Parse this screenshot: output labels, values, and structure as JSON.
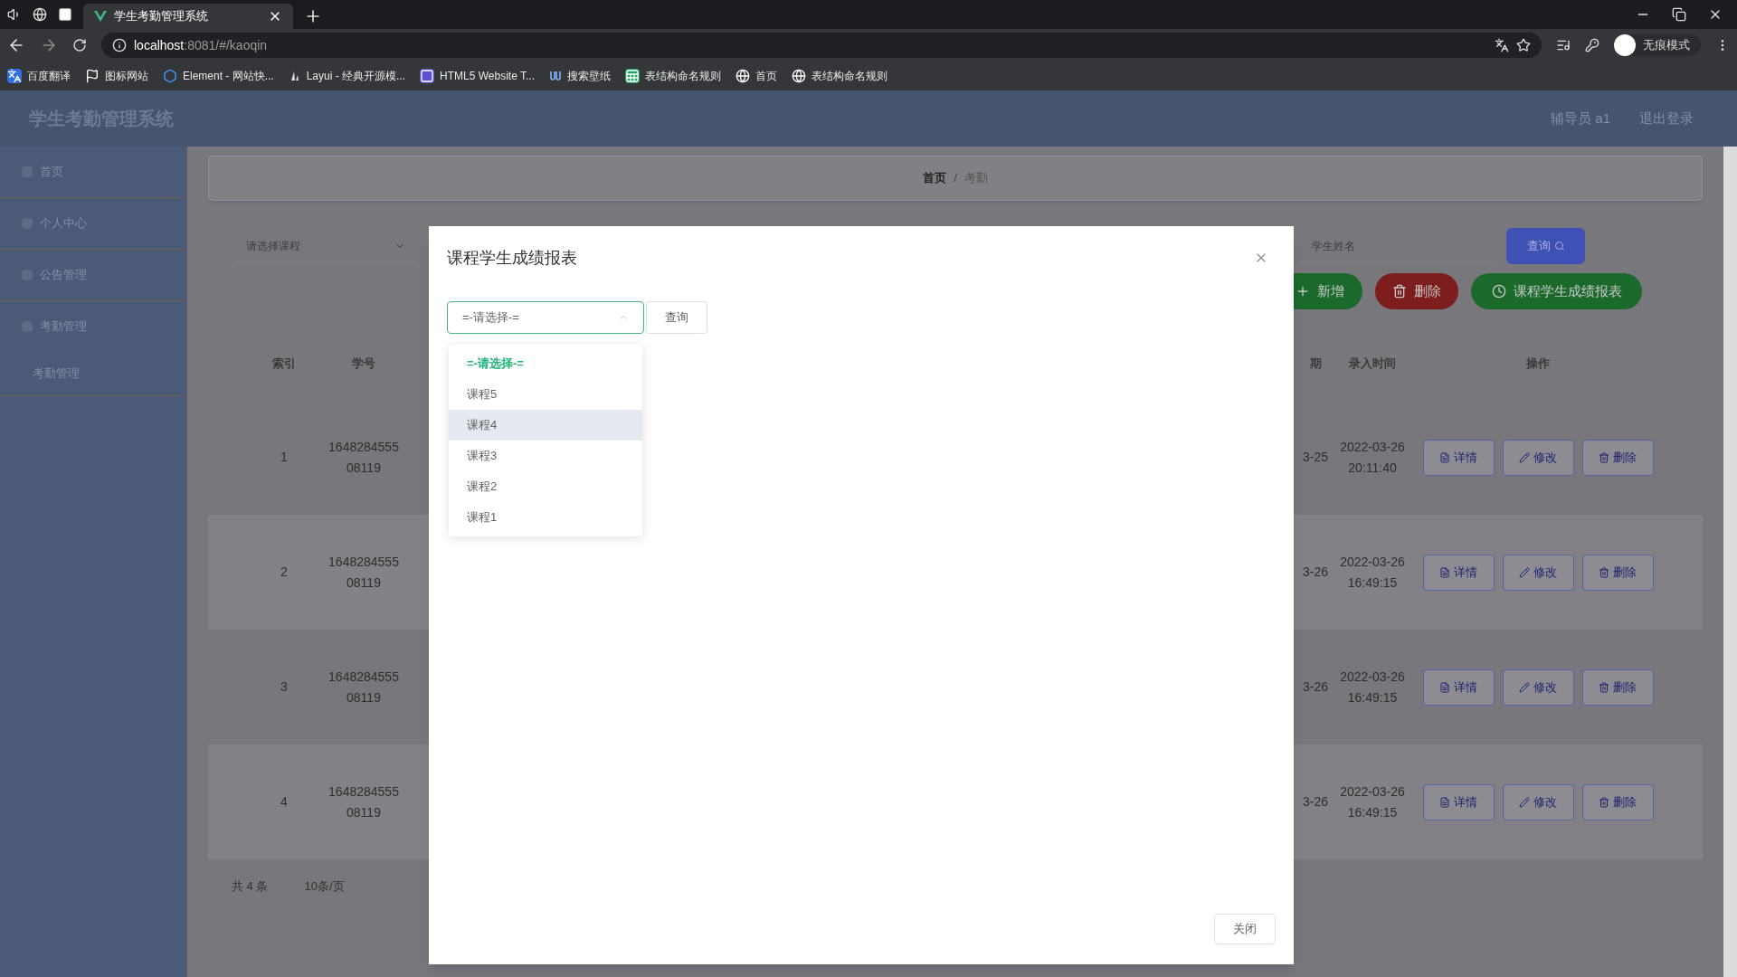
{
  "browser": {
    "tabs": [
      {
        "title": "学生考勤管理系统",
        "selected": true
      }
    ],
    "url_host": "localhost",
    "url_path": ":8081/#/kaoqin",
    "profile": "无痕模式",
    "bookmarks": [
      {
        "label": "百度翻译",
        "kind": "translate"
      },
      {
        "label": "图标网站",
        "kind": "flag"
      },
      {
        "label": "Element - 网站快...",
        "kind": "hexagon"
      },
      {
        "label": "Layui - 经典开源模...",
        "kind": "layui"
      },
      {
        "label": "HTML5 Website T...",
        "kind": "html"
      },
      {
        "label": "搜索壁纸",
        "kind": "wallpaper"
      },
      {
        "label": "表结构命名规则",
        "kind": "sheet"
      },
      {
        "label": "首页",
        "kind": "globe"
      },
      {
        "label": "表结构命名规则",
        "kind": "globe"
      }
    ]
  },
  "app": {
    "title": "学生考勤管理系统",
    "user": "辅导员 a1",
    "logout": "退出登录",
    "sidebar": [
      {
        "label": "首页"
      },
      {
        "label": "个人中心"
      },
      {
        "label": "公告管理"
      },
      {
        "label": "考勤管理",
        "children": [
          {
            "label": "考勤管理"
          }
        ]
      }
    ],
    "breadcrumb": [
      "首页",
      "考勤"
    ],
    "breadcrumb_separator": "/",
    "filter_placeholder": "请选择课程",
    "search_placeholder": "学生姓名",
    "search_button": "查询",
    "actions": [
      {
        "label": "新增",
        "kind": "add"
      },
      {
        "label": "删除",
        "kind": "delete"
      },
      {
        "label": "课程学生成绩报表",
        "kind": "report"
      }
    ],
    "columns_left": [
      "索引",
      "学号"
    ],
    "columns_right": [
      "期",
      "录入时间",
      "操作"
    ],
    "rows": [
      {
        "index": "1",
        "student_id": "164828455508119",
        "date": "3-25",
        "entry_time": "2022-03-26 20:11:40",
        "row_actions": [
          "详情",
          "修改",
          "删除"
        ]
      },
      {
        "index": "2",
        "student_id": "164828455508119",
        "date": "3-26",
        "entry_time": "2022-03-26 16:49:15",
        "row_actions": [
          "详情",
          "修改",
          "删除"
        ]
      },
      {
        "index": "3",
        "student_id": "164828455508119",
        "date": "3-26",
        "entry_time": "2022-03-26 16:49:15",
        "row_actions": [
          "详情",
          "修改",
          "删除"
        ]
      },
      {
        "index": "4",
        "student_id": "164828455508119",
        "date": "3-26",
        "entry_time": "2022-03-26 16:49:15",
        "row_actions": [
          "详情",
          "修改",
          "删除"
        ]
      }
    ],
    "pagination": {
      "total": "共 4 条",
      "page_size": "10条/页"
    }
  },
  "dialog": {
    "title": "课程学生成绩报表",
    "select_value": "=-请选择-=",
    "query_button": "查询",
    "close_button": "关闭",
    "options": [
      {
        "label": "=-请选择-=",
        "selected": true,
        "hovered": false
      },
      {
        "label": "课程5",
        "selected": false,
        "hovered": false
      },
      {
        "label": "课程4",
        "selected": false,
        "hovered": true
      },
      {
        "label": "课程3",
        "selected": false,
        "hovered": false
      },
      {
        "label": "课程2",
        "selected": false,
        "hovered": false
      },
      {
        "label": "课程1",
        "selected": false,
        "hovered": false
      }
    ]
  }
}
